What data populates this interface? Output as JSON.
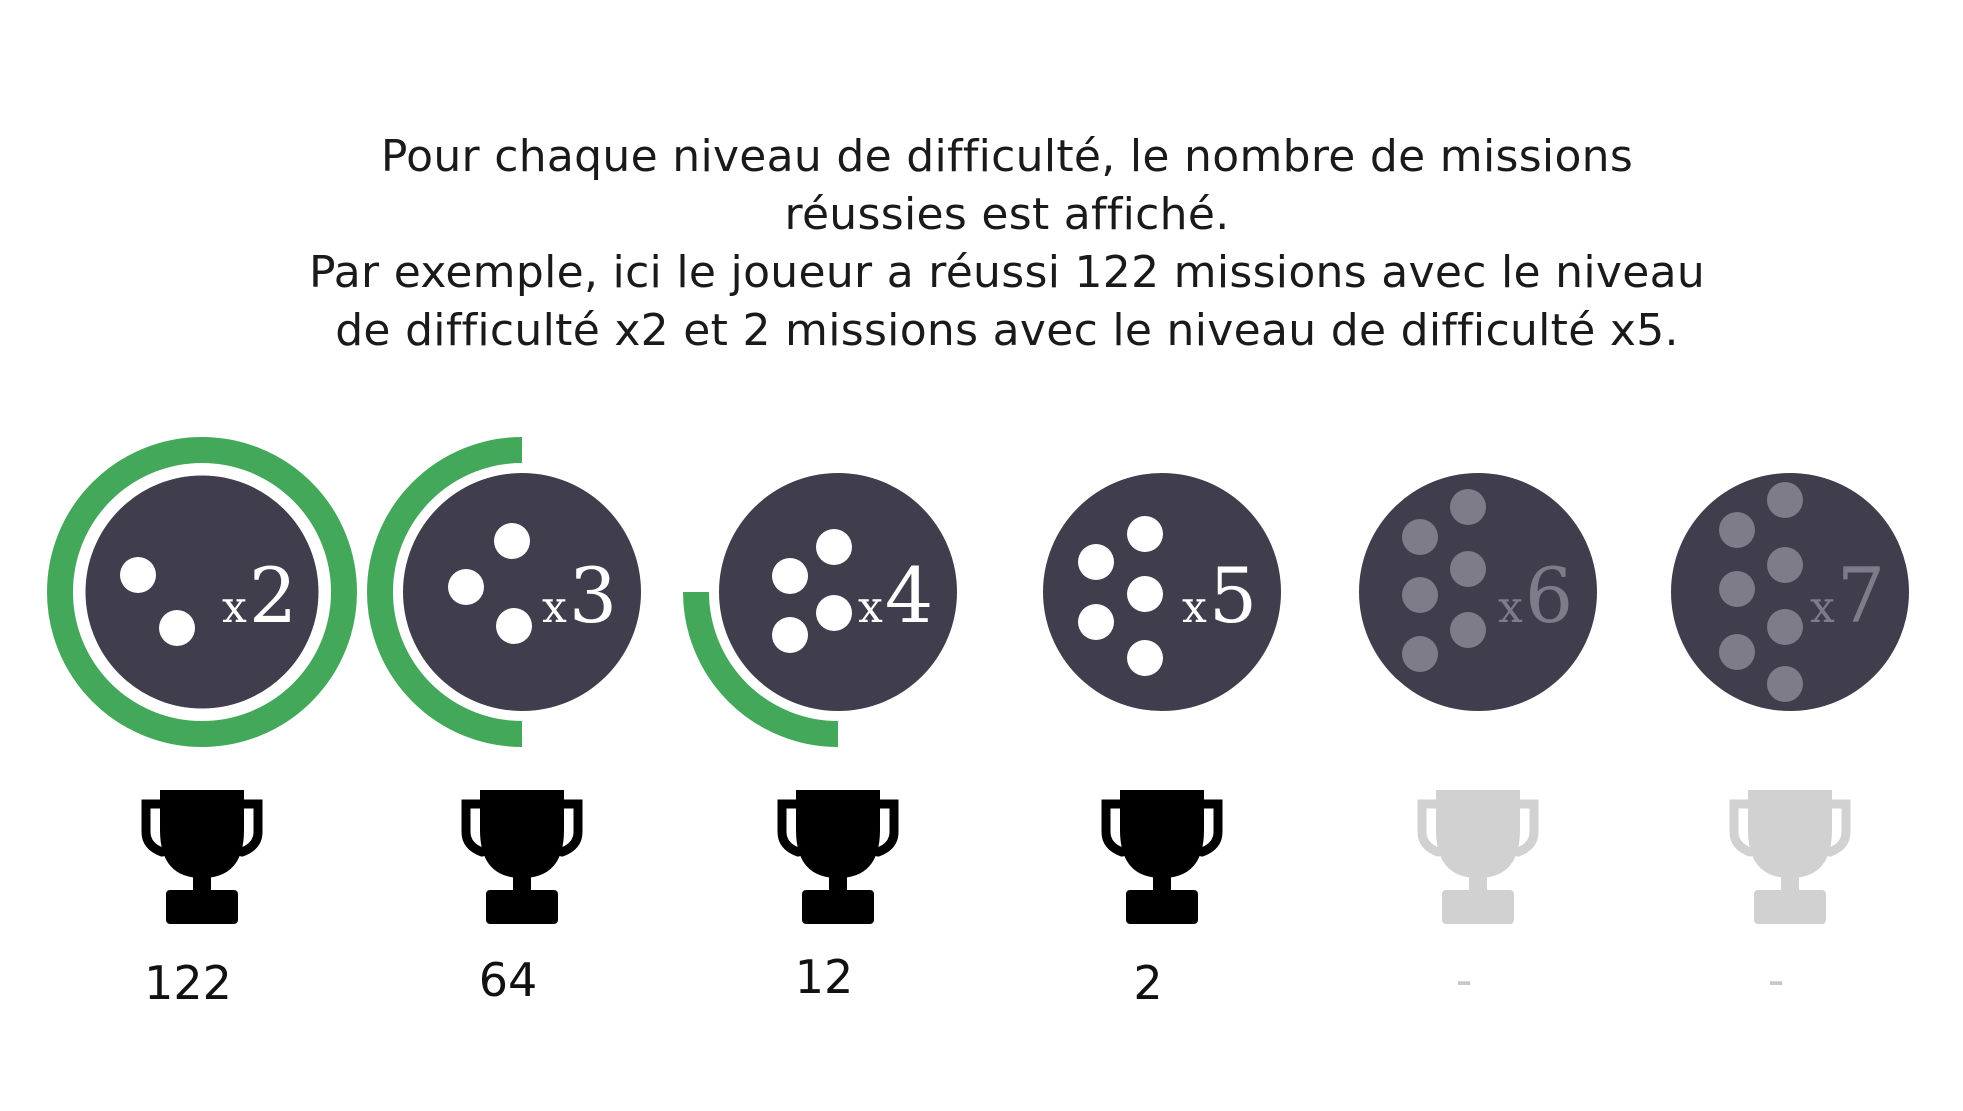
{
  "caption": {
    "line1": "Pour chaque niveau de difficulté, le nombre de missions",
    "line2": "réussies est affiché.",
    "line3": "Par exemple, ici le joueur a réussi 122 missions avec le niveau",
    "line4": "de difficulté x2 et 2 missions avec le niveau de difficulté x5."
  },
  "colors": {
    "ring": "#44a85a",
    "badge": "#403e4c",
    "dot_active": "#ffffff",
    "dot_inactive": "#7d7c88",
    "multiplier_inactive": "#7d7c88",
    "trophy_active": "#000000",
    "trophy_inactive": "#d1d1d1",
    "count_active": "#111111",
    "count_inactive": "#c8c8c8"
  },
  "levels": [
    {
      "multiplier": "x2",
      "dots": 2,
      "progress": 1.0,
      "active": true,
      "count": "122"
    },
    {
      "multiplier": "x3",
      "dots": 3,
      "progress": 0.5,
      "active": true,
      "count": "64"
    },
    {
      "multiplier": "x4",
      "dots": 4,
      "progress": 0.25,
      "active": true,
      "count": "12"
    },
    {
      "multiplier": "x5",
      "dots": 5,
      "progress": 0,
      "active": true,
      "count": "2"
    },
    {
      "multiplier": "x6",
      "dots": 6,
      "progress": 0,
      "active": false,
      "count": "-"
    },
    {
      "multiplier": "x7",
      "dots": 7,
      "progress": 0,
      "active": false,
      "count": "-"
    }
  ]
}
